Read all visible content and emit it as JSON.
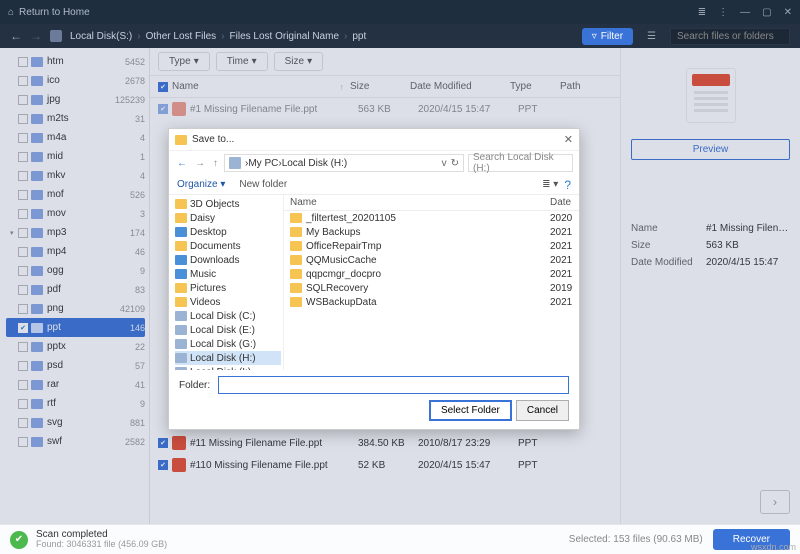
{
  "titlebar": {
    "return_home": "Return to Home"
  },
  "toolbar": {
    "trail": [
      "Local Disk(S:)",
      "Other Lost Files",
      "Files Lost Original Name",
      "ppt"
    ],
    "filter_label": "Filter",
    "search_placeholder": "Search files or folders"
  },
  "sidebar_items": [
    {
      "label": "htm",
      "count": "5452",
      "ck": false
    },
    {
      "label": "ico",
      "count": "2678",
      "ck": false
    },
    {
      "label": "jpg",
      "count": "125239",
      "ck": false
    },
    {
      "label": "m2ts",
      "count": "31",
      "ck": false
    },
    {
      "label": "m4a",
      "count": "4",
      "ck": false
    },
    {
      "label": "mid",
      "count": "1",
      "ck": false
    },
    {
      "label": "mkv",
      "count": "4",
      "ck": false
    },
    {
      "label": "mof",
      "count": "526",
      "ck": false
    },
    {
      "label": "mov",
      "count": "3",
      "ck": false
    },
    {
      "label": "mp3",
      "count": "174",
      "ck": false,
      "open": true
    },
    {
      "label": "mp4",
      "count": "46",
      "ck": false
    },
    {
      "label": "ogg",
      "count": "9",
      "ck": false
    },
    {
      "label": "pdf",
      "count": "83",
      "ck": false
    },
    {
      "label": "png",
      "count": "42109",
      "ck": false
    },
    {
      "label": "ppt",
      "count": "146",
      "ck": true,
      "sel": true
    },
    {
      "label": "pptx",
      "count": "22",
      "ck": false
    },
    {
      "label": "psd",
      "count": "57",
      "ck": false
    },
    {
      "label": "rar",
      "count": "41",
      "ck": false
    },
    {
      "label": "rtf",
      "count": "9",
      "ck": false
    },
    {
      "label": "svg",
      "count": "881",
      "ck": false
    },
    {
      "label": "swf",
      "count": "2582",
      "ck": false
    }
  ],
  "filter_buttons": {
    "type": "Type",
    "time": "Time",
    "size": "Size"
  },
  "columns": {
    "name": "Name",
    "size": "Size",
    "date": "Date Modified",
    "type": "Type",
    "path": "Path"
  },
  "files": [
    {
      "name": "#1 Missing Filename File.ppt",
      "size": "563 KB",
      "date": "2020/4/15 15:47",
      "type": "PPT"
    },
    {
      "name": "#11 Missing Filename File.ppt",
      "size": "384.50 KB",
      "date": "2010/8/17 23:29",
      "type": "PPT"
    },
    {
      "name": "#110 Missing Filename File.ppt",
      "size": "52 KB",
      "date": "2020/4/15 15:47",
      "type": "PPT"
    }
  ],
  "preview": {
    "button": "Preview"
  },
  "props": {
    "name_label": "Name",
    "name_val": "#1 Missing Filena...",
    "size_label": "Size",
    "size_val": "563 KB",
    "date_label": "Date Modified",
    "date_val": "2020/4/15 15:47"
  },
  "bottom": {
    "scan_title": "Scan completed",
    "scan_sub": "Found: 3046331 file (456.09 GB)",
    "selected": "Selected: 153 files (90.63 MB)",
    "recover": "Recover"
  },
  "dialog": {
    "title": "Save to...",
    "path_segments": [
      "My PC",
      "Local Disk (H:)"
    ],
    "search_placeholder": "Search Local Disk (H:)",
    "organize": "Organize",
    "newfolder": "New folder",
    "tree": [
      {
        "label": "3D Objects",
        "icon": "folder"
      },
      {
        "label": "Daisy",
        "icon": "folder"
      },
      {
        "label": "Desktop",
        "icon": "blue"
      },
      {
        "label": "Documents",
        "icon": "folder"
      },
      {
        "label": "Downloads",
        "icon": "blue"
      },
      {
        "label": "Music",
        "icon": "blue"
      },
      {
        "label": "Pictures",
        "icon": "folder"
      },
      {
        "label": "Videos",
        "icon": "folder"
      },
      {
        "label": "Local Disk (C:)",
        "icon": "disk"
      },
      {
        "label": "Local Disk (E:)",
        "icon": "disk"
      },
      {
        "label": "Local Disk (G:)",
        "icon": "disk"
      },
      {
        "label": "Local Disk (H:)",
        "icon": "disk",
        "sel": true
      },
      {
        "label": "Local Disk (I:)",
        "icon": "disk"
      }
    ],
    "col_name": "Name",
    "col_date": "Date",
    "folders": [
      {
        "name": "_filtertest_20201105",
        "date": "2020"
      },
      {
        "name": "My Backups",
        "date": "2021"
      },
      {
        "name": "OfficeRepairTmp",
        "date": "2021"
      },
      {
        "name": "QQMusicCache",
        "date": "2021"
      },
      {
        "name": "qqpcmgr_docpro",
        "date": "2021"
      },
      {
        "name": "SQLRecovery",
        "date": "2019"
      },
      {
        "name": "WSBackupData",
        "date": "2021"
      }
    ],
    "folder_label": "Folder:",
    "select_btn": "Select Folder",
    "cancel_btn": "Cancel"
  },
  "watermark": "wsxdn.com"
}
